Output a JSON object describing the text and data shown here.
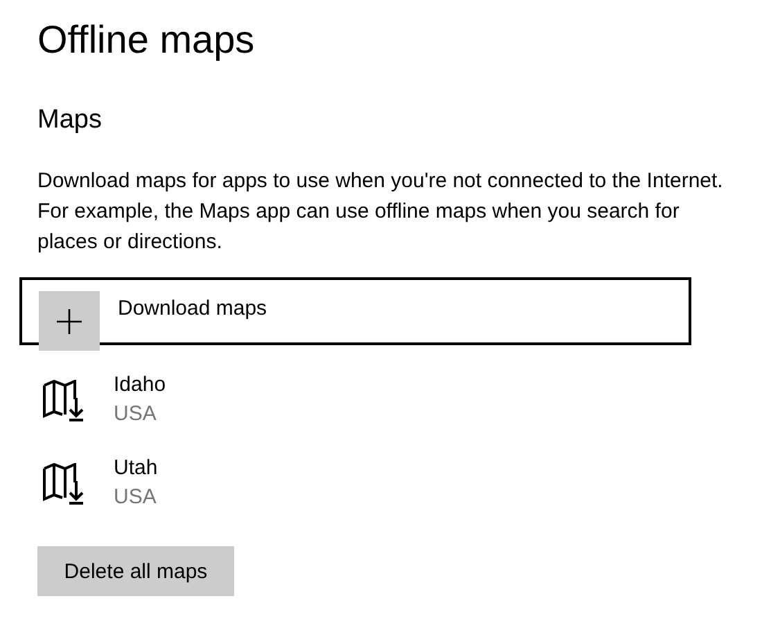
{
  "title": "Offline maps",
  "section": {
    "heading": "Maps",
    "description": "Download maps for apps to use when you're not connected to the Internet. For example, the Maps app can use offline maps when you search for places or directions."
  },
  "download": {
    "label": "Download maps",
    "focused": true
  },
  "maps": [
    {
      "name": "Idaho",
      "region": "USA"
    },
    {
      "name": "Utah",
      "region": "USA"
    }
  ],
  "delete_button": "Delete all maps"
}
